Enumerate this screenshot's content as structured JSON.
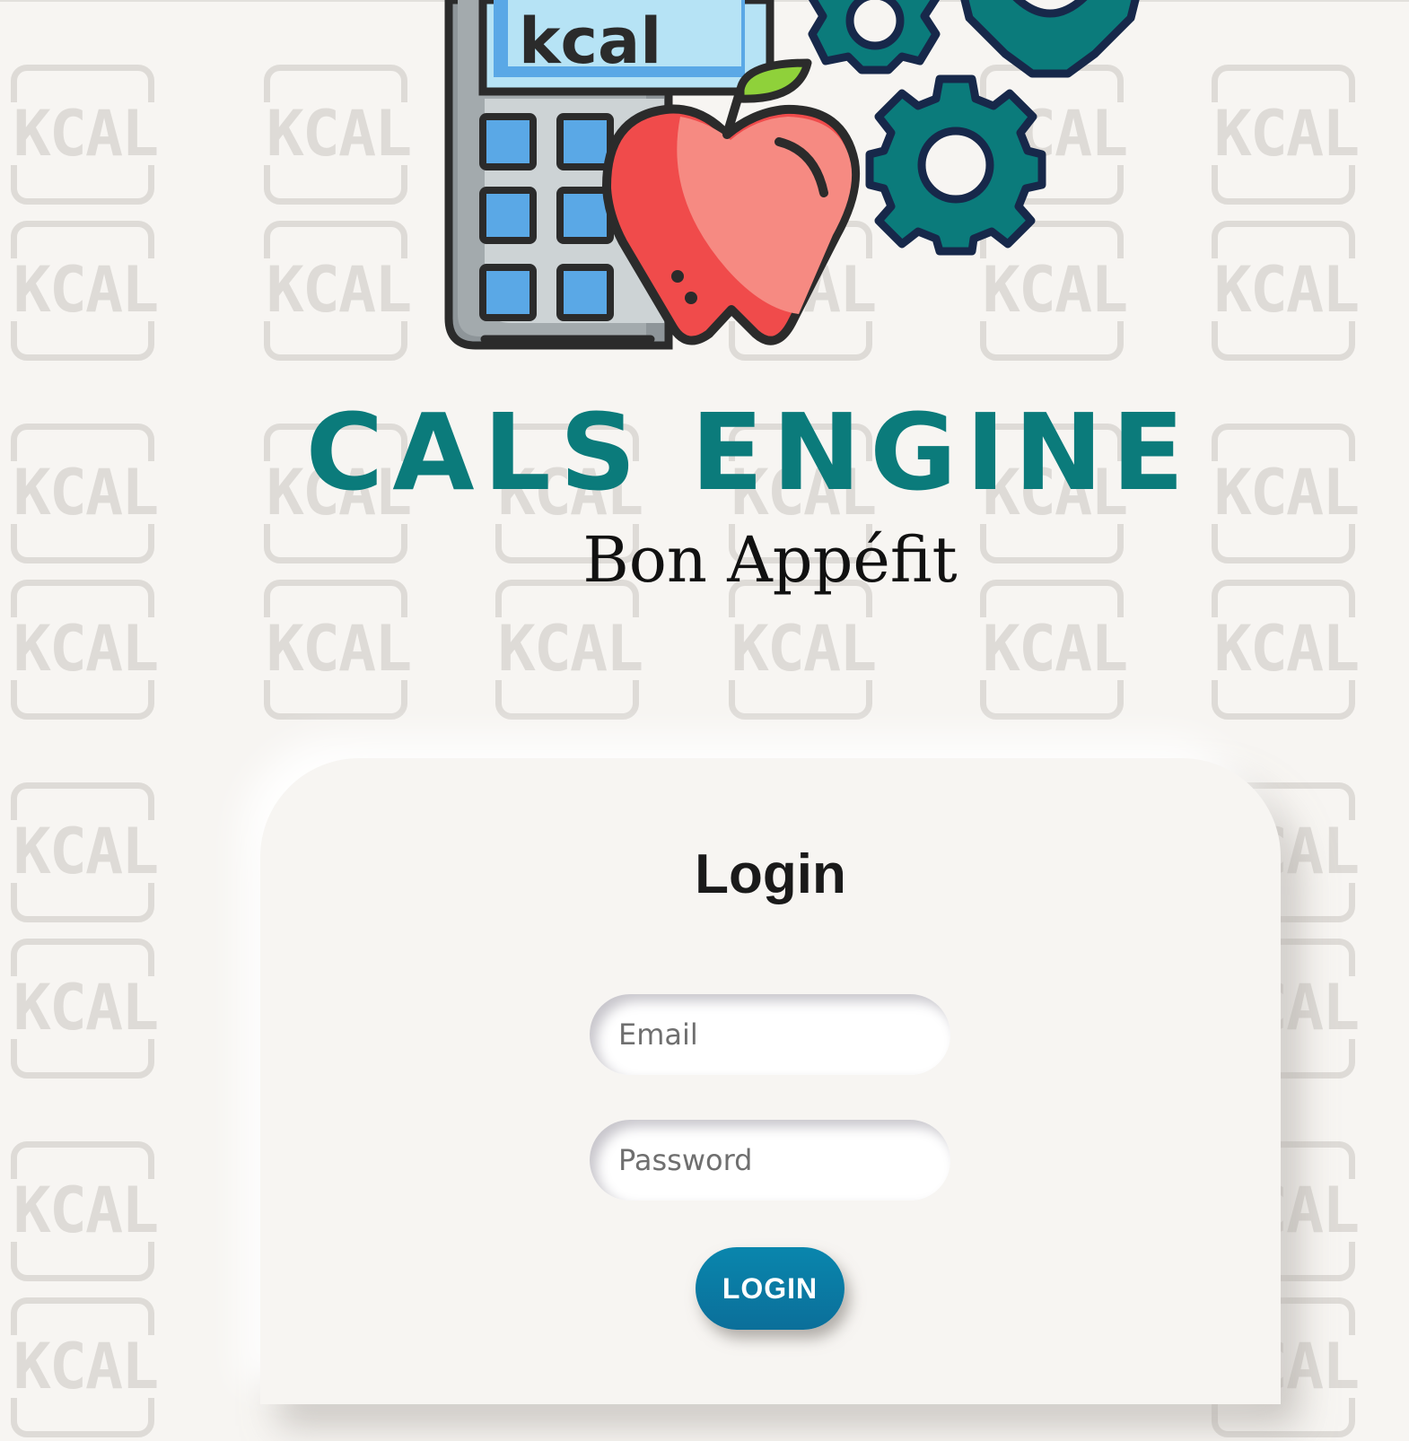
{
  "background": {
    "watermark_text": "KCAL",
    "colors": {
      "page": "#f7f5f2",
      "watermark": "#dedbd7"
    }
  },
  "logo": {
    "screen_text": "kcal",
    "icons": [
      "calculator-icon",
      "apple-icon",
      "gear-icon"
    ],
    "colors": {
      "teal": "#0b7b7b",
      "apple": "#f04b4b",
      "leaf": "#8fd13a",
      "screen": "#5aa8e6"
    }
  },
  "brand": {
    "title": "CALS ENGINE",
    "tagline": "Bon Appéfit",
    "title_color": "#0b7b7b"
  },
  "login": {
    "heading": "Login",
    "email_placeholder": "Email",
    "password_placeholder": "Password",
    "button_label": "LOGIN",
    "button_color": "#0a7ea8"
  }
}
